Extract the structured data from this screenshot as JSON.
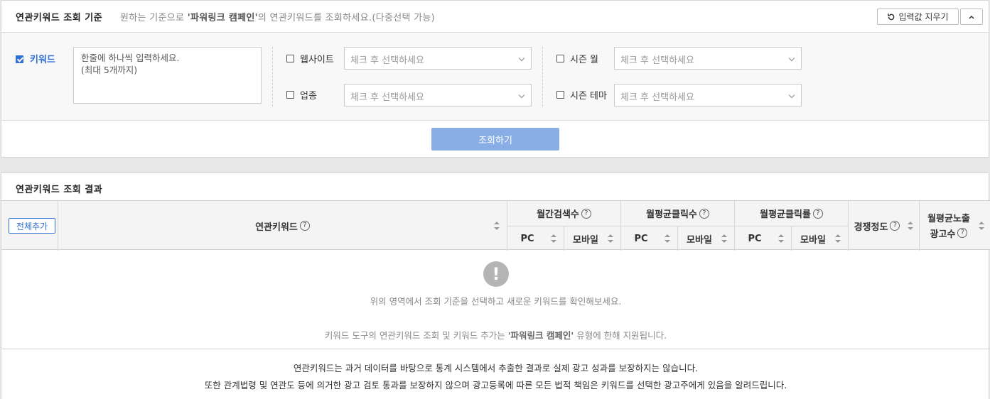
{
  "criteria": {
    "title": "연관키워드 조회 기준",
    "desc_pre": "원하는 기준으로 ",
    "desc_bold": "'파워링크 캠페인'",
    "desc_post": "의 연관키워드를 조회하세요.(다중선택 가능)",
    "reset_label": "입력값 지우기",
    "keyword_label": "키워드",
    "keyword_checked": true,
    "keyword_placeholder": "한줄에 하나씩 입력하세요.\n(최대 5개까지)",
    "website_label": "웹사이트",
    "industry_label": "업종",
    "season_month_label": "시즌 월",
    "season_theme_label": "시즌 테마",
    "select_placeholder": "체크 후 선택하세요",
    "search_label": "조회하기"
  },
  "results": {
    "title": "연관키워드 조회 결과",
    "add_all_label": "전체추가",
    "columns": {
      "keyword": "연관키워드",
      "monthly_search": "월간검색수",
      "monthly_clicks": "월평균클릭수",
      "monthly_ctr": "월평균클릭률",
      "competition": "경쟁정도",
      "ad_count_line1": "월평균노출",
      "ad_count_line2": "광고수",
      "pc": "PC",
      "mobile": "모바일"
    },
    "empty_icon": "!",
    "empty_msg": "위의 영역에서 조회 기준을 선택하고 새로운 키워드를 확인해보세요.",
    "support_pre": "키워드 도구의 연관키워드 조회 및 키워드 추가는 ",
    "support_bold": "'파워링크 캠페인'",
    "support_post": " 유형에 한해 지원됩니다.",
    "notice_1": "연관키워드는 과거 데이터를 바탕으로 통계 시스템에서 추출한 결과로 실제 광고 성과를 보장하지는 않습니다.",
    "notice_2": "또한 관계법령 및 연관도 등에 의거한 광고 검토 통과를 보장하지 않으며 광고등록에 따른 모든 법적 책임은 키워드를 선택한 광고주에게 있음을 알려드립니다."
  }
}
